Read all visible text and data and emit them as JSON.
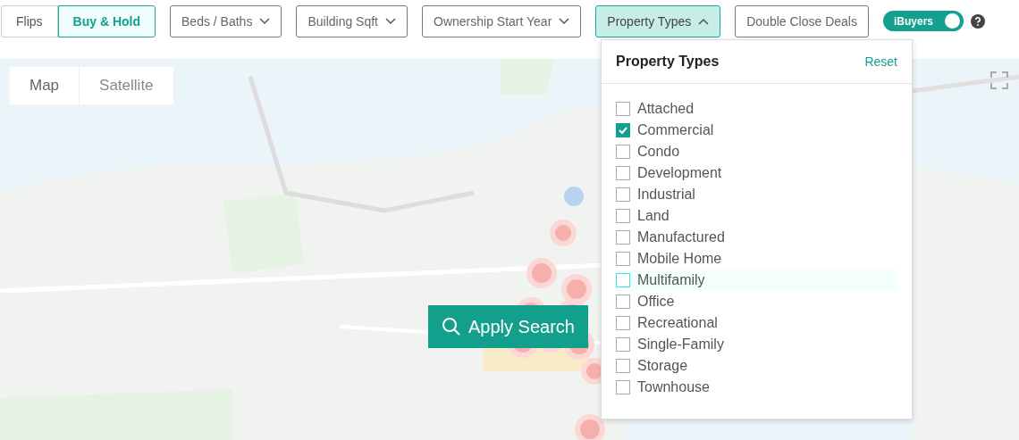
{
  "strategy_tabs": [
    {
      "label": "Flips",
      "selected": false
    },
    {
      "label": "Buy & Hold",
      "selected": true
    }
  ],
  "filters": [
    {
      "label": "Beds / Baths",
      "kind": "dropdown",
      "expanded": false
    },
    {
      "label": "Building Sqft",
      "kind": "dropdown",
      "expanded": false
    },
    {
      "label": "Ownership Start Year",
      "kind": "dropdown",
      "expanded": false
    },
    {
      "label": "Property Types",
      "kind": "dropdown",
      "expanded": true
    },
    {
      "label": "Double Close Deals",
      "kind": "plain",
      "expanded": false
    }
  ],
  "ibuyers_toggle": {
    "label": "iBuyers",
    "on": true
  },
  "property_types_panel": {
    "title": "Property Types",
    "reset": "Reset",
    "options": [
      {
        "label": "Attached",
        "checked": false,
        "focused": false
      },
      {
        "label": "Commercial",
        "checked": true,
        "focused": false
      },
      {
        "label": "Condo",
        "checked": false,
        "focused": false
      },
      {
        "label": "Development",
        "checked": false,
        "focused": false
      },
      {
        "label": "Industrial",
        "checked": false,
        "focused": false
      },
      {
        "label": "Land",
        "checked": false,
        "focused": false
      },
      {
        "label": "Manufactured",
        "checked": false,
        "focused": false
      },
      {
        "label": "Mobile Home",
        "checked": false,
        "focused": false
      },
      {
        "label": "Multifamily",
        "checked": false,
        "focused": true
      },
      {
        "label": "Office",
        "checked": false,
        "focused": false
      },
      {
        "label": "Recreational",
        "checked": false,
        "focused": false
      },
      {
        "label": "Single-Family",
        "checked": false,
        "focused": false
      },
      {
        "label": "Storage",
        "checked": false,
        "focused": false
      },
      {
        "label": "Townhouse",
        "checked": false,
        "focused": false
      }
    ]
  },
  "map": {
    "kind": "picture",
    "type_tabs": [
      {
        "label": "Map",
        "selected": true
      },
      {
        "label": "Satellite",
        "selected": false
      }
    ],
    "apply_button": "Apply Search"
  }
}
